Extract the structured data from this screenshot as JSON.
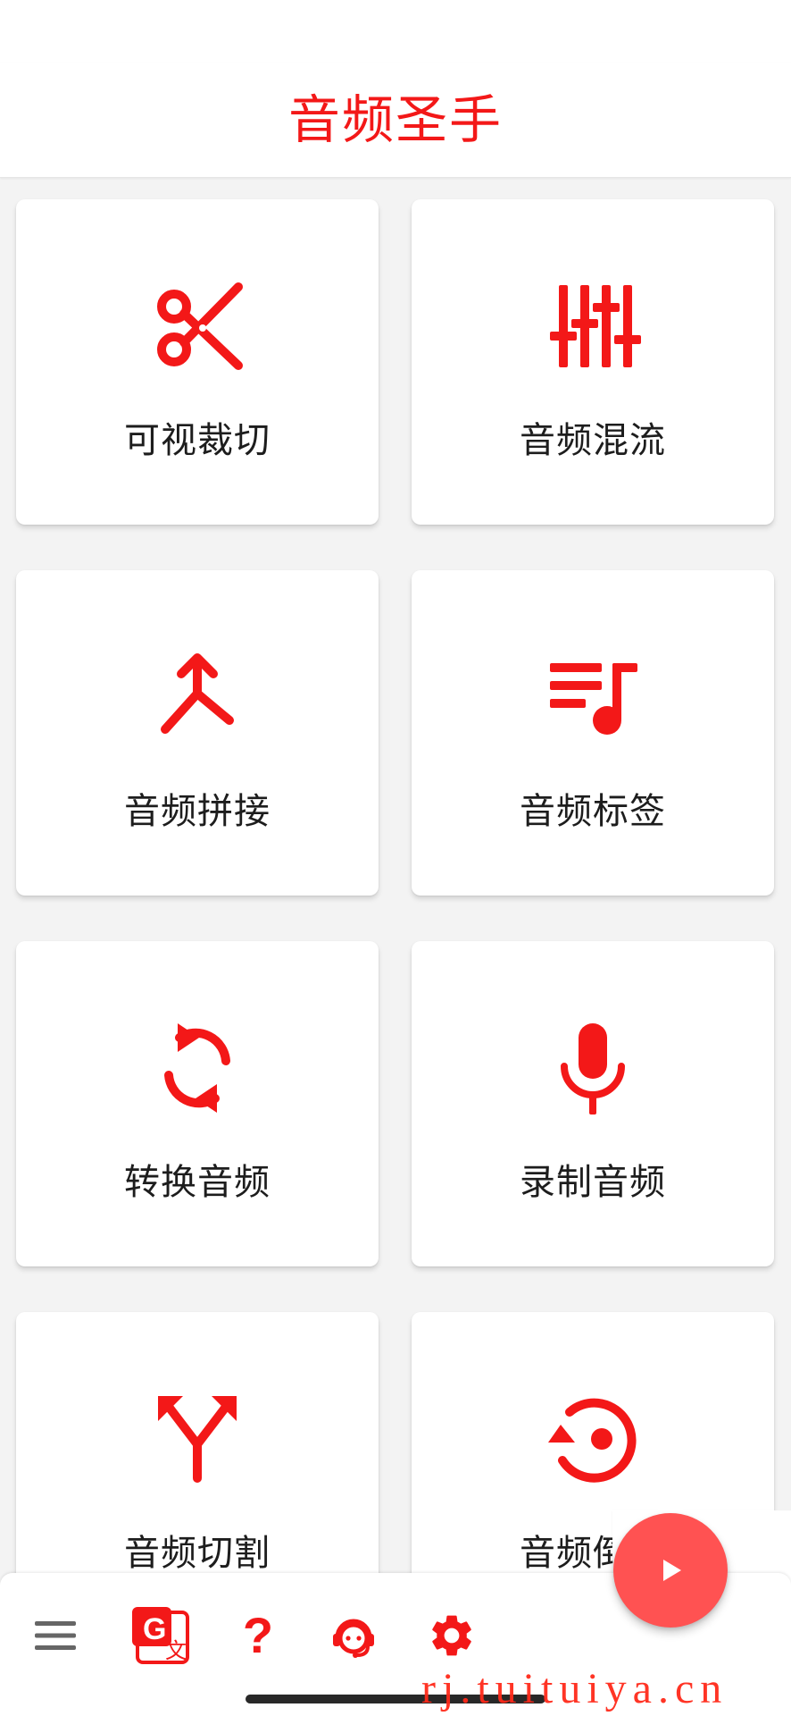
{
  "header": {
    "title": "音频圣手"
  },
  "colors": {
    "accent": "#f31818",
    "fab": "#ff5252",
    "bottom_icon_gray": "#666666"
  },
  "tiles": [
    {
      "label": "可视裁切",
      "icon": "scissors-icon"
    },
    {
      "label": "音频混流",
      "icon": "equalizer-icon"
    },
    {
      "label": "音频拼接",
      "icon": "merge-icon"
    },
    {
      "label": "音频标签",
      "icon": "music-list-icon"
    },
    {
      "label": "转换音频",
      "icon": "sync-icon"
    },
    {
      "label": "录制音频",
      "icon": "microphone-icon"
    },
    {
      "label": "音频切割",
      "icon": "split-icon"
    },
    {
      "label": "音频倒放",
      "icon": "reverse-icon"
    }
  ],
  "bottom_nav": {
    "items": [
      {
        "icon": "menu-icon"
      },
      {
        "icon": "translate-icon"
      },
      {
        "icon": "help-icon"
      },
      {
        "icon": "support-agent-icon"
      },
      {
        "icon": "settings-icon"
      }
    ],
    "fab_icon": "play-icon",
    "help_glyph": "?",
    "translate_left": "G",
    "translate_right": "文"
  },
  "watermark": "rj.tuituiya.cn"
}
